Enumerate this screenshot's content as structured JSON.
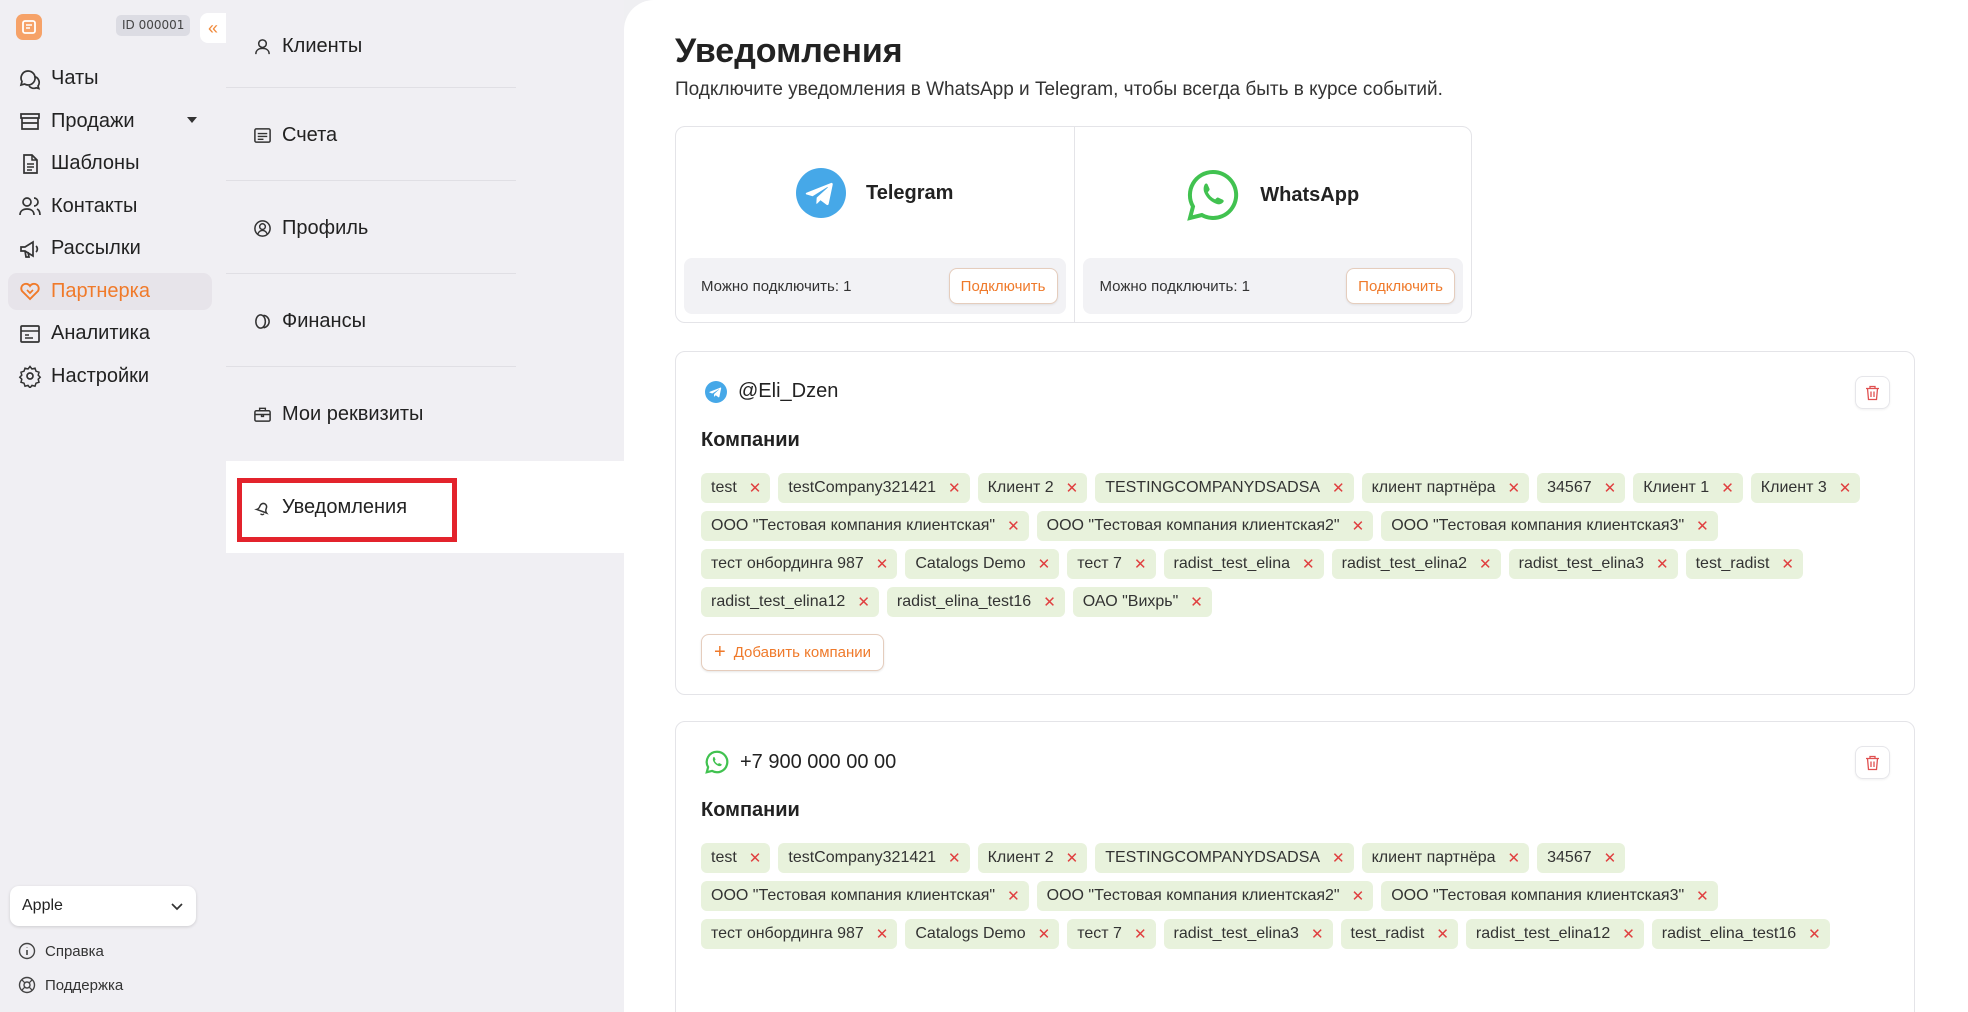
{
  "sidebar": {
    "id_badge": "ID 000001",
    "collapse_icon": "«",
    "items": [
      {
        "label": "Чаты",
        "icon": "chat-icon"
      },
      {
        "label": "Продажи",
        "icon": "store-icon"
      },
      {
        "label": "Шаблоны",
        "icon": "document-icon"
      },
      {
        "label": "Контакты",
        "icon": "users-icon"
      },
      {
        "label": "Рассылки",
        "icon": "megaphone-icon"
      },
      {
        "label": "Партнерка",
        "icon": "handshake-icon"
      },
      {
        "label": "Аналитика",
        "icon": "analytics-icon"
      },
      {
        "label": "Настройки",
        "icon": "gear-icon"
      }
    ],
    "active": "Партнерка",
    "company_select": "Apple",
    "help": "Справка",
    "support": "Поддержка"
  },
  "menu": {
    "items": [
      "Клиенты",
      "Счета",
      "Профиль",
      "Финансы",
      "Мои реквизиты",
      "Уведомления"
    ],
    "active": "Уведомления"
  },
  "main": {
    "title": "Уведомления",
    "subtitle": "Подключите уведомления в WhatsApp и Telegram, чтобы всегда быть в курсе событий.",
    "channels": [
      {
        "name": "Telegram",
        "available": "Можно подключить: 1",
        "button": "Подключить",
        "color": "#46a8e8"
      },
      {
        "name": "WhatsApp",
        "available": "Можно подключить: 1",
        "button": "Подключить",
        "color": "#41c250"
      }
    ],
    "accounts": [
      {
        "type": "telegram",
        "handle": "@Eli_Dzen",
        "companies_title": "Компании",
        "companies": [
          "test",
          "testCompany321421",
          "Клиент 2",
          "TESTINGCOMPANYDSADSA",
          "клиент партнёра",
          "34567",
          "Клиент 1",
          "Клиент 3",
          "ООО \"Тестовая компания клиентская\"",
          "ООО \"Тестовая компания клиентская2\"",
          "ООО \"Тестовая компания клиентская3\"",
          "тест онбординга 987",
          "Catalogs Demo",
          "тест 7",
          "radist_test_elina",
          "radist_test_elina2",
          "radist_test_elina3",
          "test_radist",
          "radist_test_elina12",
          "radist_elina_test16",
          "ОАО \"Вихрь\""
        ],
        "add_button": "Добавить компании"
      },
      {
        "type": "whatsapp",
        "handle": "+7 900 000 00 00",
        "companies_title": "Компании",
        "companies": [
          "test",
          "testCompany321421",
          "Клиент 2",
          "TESTINGCOMPANYDSADSA",
          "клиент партнёра",
          "34567",
          "ООО \"Тестовая компания клиентская\"",
          "ООО \"Тестовая компания клиентская2\"",
          "ООО \"Тестовая компания клиентская3\"",
          "тест онбординга 987",
          "Catalogs Demo",
          "тест 7",
          "radist_test_elina3",
          "test_radist",
          "radist_test_elina12",
          "radist_elina_test16"
        ]
      }
    ],
    "tag_remove": "✕",
    "add_icon": "+"
  }
}
